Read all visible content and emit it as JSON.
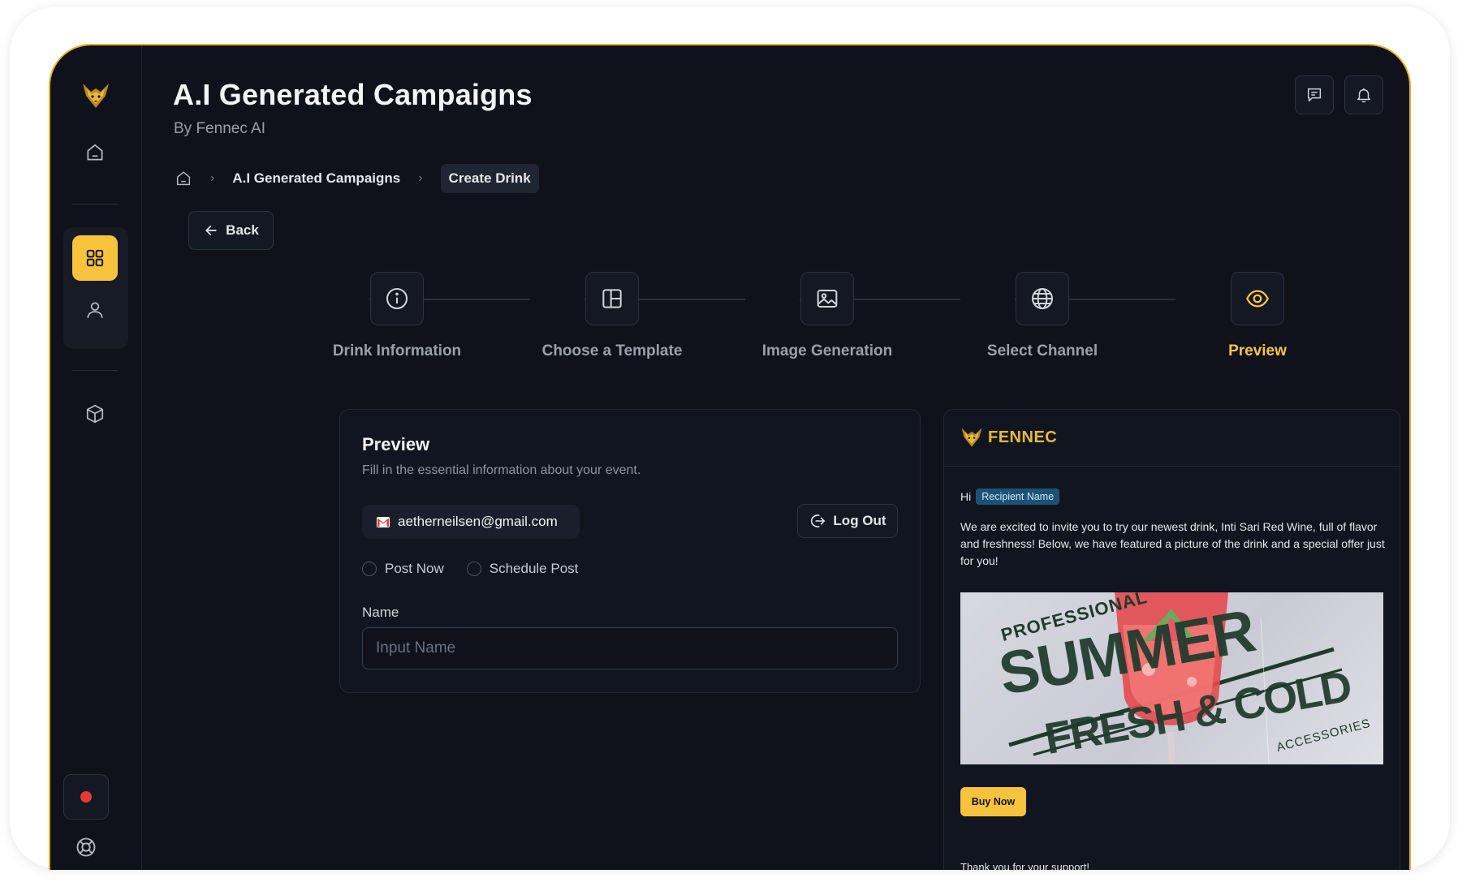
{
  "header": {
    "title": "A.I Generated Campaigns",
    "subtitle": "By Fennec AI"
  },
  "breadcrumb": {
    "items": [
      "A.I Generated Campaigns",
      "Create Drink"
    ]
  },
  "back_label": "Back",
  "steps": [
    {
      "label": "Drink Information",
      "icon": "info-icon",
      "active": false
    },
    {
      "label": "Choose a Template",
      "icon": "template-icon",
      "active": false
    },
    {
      "label": "Image Generation",
      "icon": "image-icon",
      "active": false
    },
    {
      "label": "Select Channel",
      "icon": "globe-icon",
      "active": false
    },
    {
      "label": "Preview",
      "icon": "eye-icon",
      "active": true
    }
  ],
  "form": {
    "title": "Preview",
    "description": "Fill in the essential information about your event.",
    "email": "aetherneilsen@gmail.com",
    "logout_label": "Log Out",
    "radio_post_now": "Post Now",
    "radio_schedule": "Schedule Post",
    "name_label": "Name",
    "name_placeholder": "Input Name"
  },
  "email_preview": {
    "brand": "FENNEC",
    "greeting": "Hi",
    "recipient_tag": "Recipient Name",
    "body": "We are excited to invite you to try our newest drink, Inti Sari Red Wine, full of flavor and freshness! Below, we have featured a picture of the drink and a special offer just for you!",
    "image_text_top": "PROFESSIONAL",
    "image_text_main_1": "SUMMER",
    "image_text_main_2": "FRESH & COLD",
    "image_text_bottom": "ACCESSORIES",
    "buy_label": "Buy Now",
    "thanks": "Thank you for your support!"
  },
  "colors": {
    "accent": "#f8c33c",
    "background": "#0f121b",
    "frame_border": "#e4b024",
    "recording": "#e53935"
  }
}
